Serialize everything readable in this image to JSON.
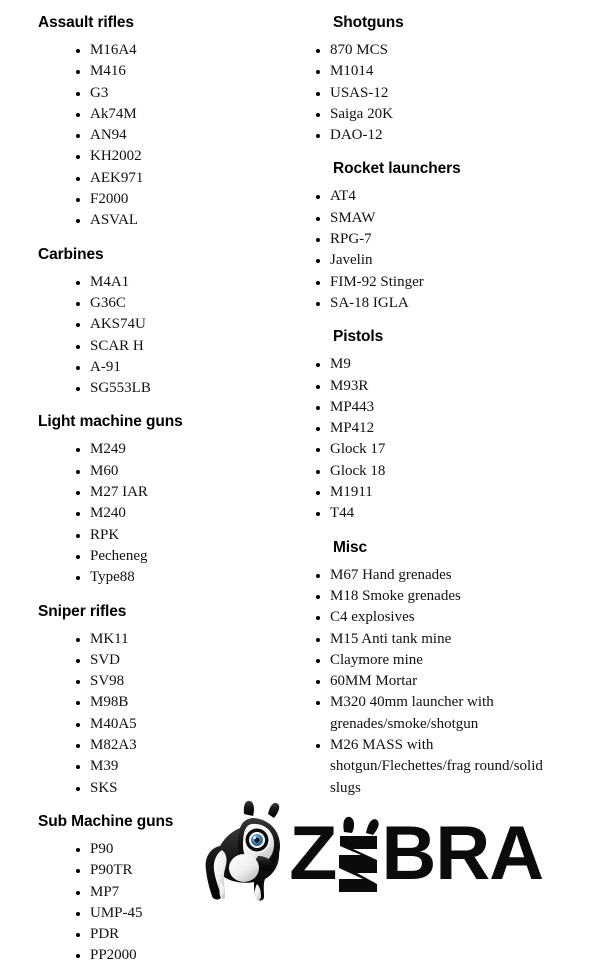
{
  "document": {
    "background_color": "#ffffff",
    "text_color": "#000000"
  },
  "columns": {
    "left": [
      {
        "heading": "Assault rifles",
        "items": [
          "M16A4",
          "M416",
          "G3",
          "Ak74M",
          "AN94",
          "KH2002",
          "AEK971",
          "F2000",
          "ASVAL"
        ]
      },
      {
        "heading": "Carbines",
        "items": [
          "M4A1",
          "G36C",
          "AKS74U",
          "SCAR H",
          "A-91",
          "SG553LB"
        ]
      },
      {
        "heading": "Light machine guns",
        "items": [
          "M249",
          "M60",
          "M27 IAR",
          "M240",
          "RPK",
          "Pecheneg",
          "Type88"
        ]
      },
      {
        "heading": "Sniper rifles",
        "items": [
          "MK11",
          "SVD",
          "SV98",
          "M98B",
          "M40A5",
          "M82A3",
          "M39",
          "SKS"
        ]
      },
      {
        "heading": "Sub Machine guns",
        "items": [
          "P90",
          "P90TR",
          "MP7",
          "UMP-45",
          "PDR",
          "PP2000"
        ]
      }
    ],
    "right": [
      {
        "heading": "Shotguns",
        "items": [
          "870 MCS",
          "M1014",
          "USAS-12",
          "Saiga 20K",
          "DAO-12"
        ]
      },
      {
        "heading": "Rocket launchers",
        "items": [
          "AT4",
          "SMAW",
          "RPG-7",
          "Javelin",
          "FIM-92 Stinger",
          "SA-18 IGLA"
        ]
      },
      {
        "heading": "Pistols",
        "items": [
          "M9",
          "M93R",
          "MP443",
          "MP412",
          "Glock 17",
          "Glock 18",
          "M1911",
          "T44"
        ]
      },
      {
        "heading": "Misc",
        "items": [
          "M67 Hand grenades",
          "M18 Smoke grenades",
          "C4 explosives",
          "M15 Anti tank mine",
          "Claymore mine",
          "60MM Mortar",
          "M320 40mm launcher with grenades/smoke/shotgun",
          "M26 MASS with shotgun/Flechettes/frag round/solid slugs"
        ]
      }
    ]
  },
  "logo": {
    "wordmark_before": "Z",
    "wordmark_after": "BRA",
    "full_text": "ZEBRA",
    "mascot_name": "zebra-mascot",
    "colors": {
      "body_dark": "#141414",
      "body_light": "#f2f2f2",
      "eye_iris": "#3f7fb5",
      "eye_pupil": "#0b1b2b",
      "wordmark": "#0b0b0b"
    }
  }
}
